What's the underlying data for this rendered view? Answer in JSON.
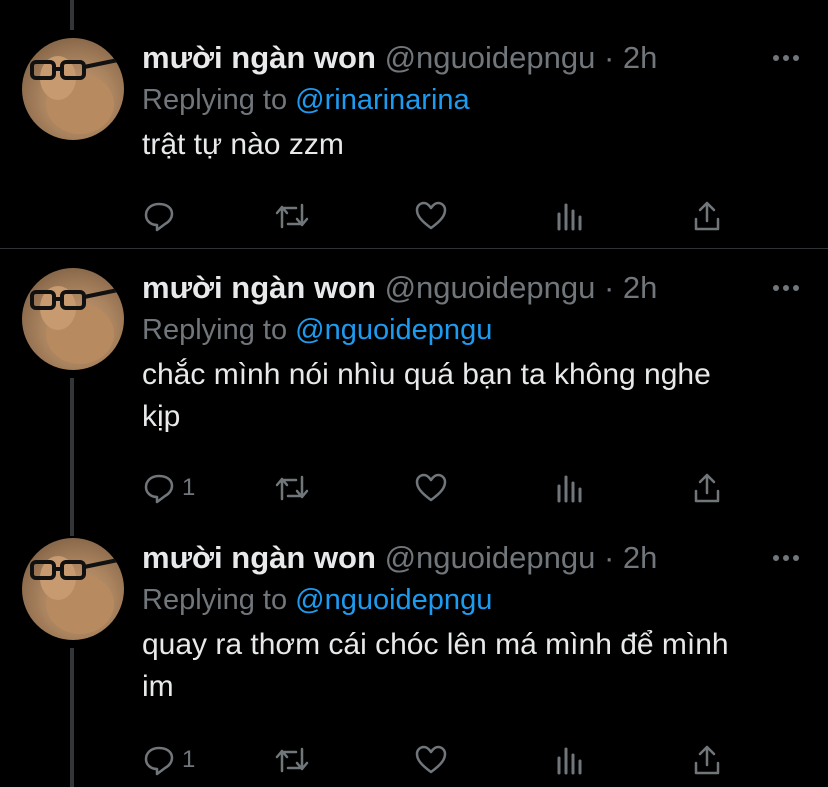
{
  "colors": {
    "background": "#000000",
    "text": "#e7e9ea",
    "muted": "#71767b",
    "link": "#1d9bf0",
    "divider": "#2f3336"
  },
  "tweets": [
    {
      "name": "mười ngàn won",
      "handle": "@nguoidepngu",
      "dot": "·",
      "time": "2h",
      "reply_prefix": "Replying to",
      "reply_to": "@rinarinarina",
      "text": "trật tự nào zzm",
      "reply_count": "",
      "icons": [
        "reply-icon",
        "retweet-icon",
        "like-icon",
        "analytics-icon",
        "share-icon"
      ]
    },
    {
      "name": "mười ngàn won",
      "handle": "@nguoidepngu",
      "dot": "·",
      "time": "2h",
      "reply_prefix": "Replying to",
      "reply_to": "@nguoidepngu",
      "text": "chắc mình nói nhìu quá bạn ta không nghe kịp",
      "reply_count": "1",
      "icons": [
        "reply-icon",
        "retweet-icon",
        "like-icon",
        "analytics-icon",
        "share-icon"
      ]
    },
    {
      "name": "mười ngàn won",
      "handle": "@nguoidepngu",
      "dot": "·",
      "time": "2h",
      "reply_prefix": "Replying to",
      "reply_to": "@nguoidepngu",
      "text": "quay ra thơm cái chóc lên má mình để mình im",
      "reply_count": "1",
      "icons": [
        "reply-icon",
        "retweet-icon",
        "like-icon",
        "analytics-icon",
        "share-icon"
      ]
    }
  ]
}
